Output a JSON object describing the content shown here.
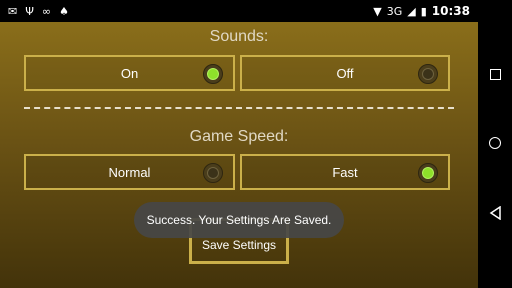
{
  "status_bar": {
    "left_icons": [
      "mail-icon",
      "usb-icon",
      "incognito-icon",
      "android-icon"
    ],
    "network": "3G",
    "time": "10:38"
  },
  "settings": {
    "sounds": {
      "title": "Sounds:",
      "options": [
        {
          "label": "On",
          "selected": true
        },
        {
          "label": "Off",
          "selected": false
        }
      ]
    },
    "game_speed": {
      "title": "Game Speed:",
      "options": [
        {
          "label": "Normal",
          "selected": false
        },
        {
          "label": "Fast",
          "selected": true
        }
      ]
    },
    "save_button": "Save Settings"
  },
  "toast": "Success. Your Settings Are Saved.",
  "colors": {
    "border_gold": "#cbb04a",
    "selected_green": "#8ee02a"
  }
}
